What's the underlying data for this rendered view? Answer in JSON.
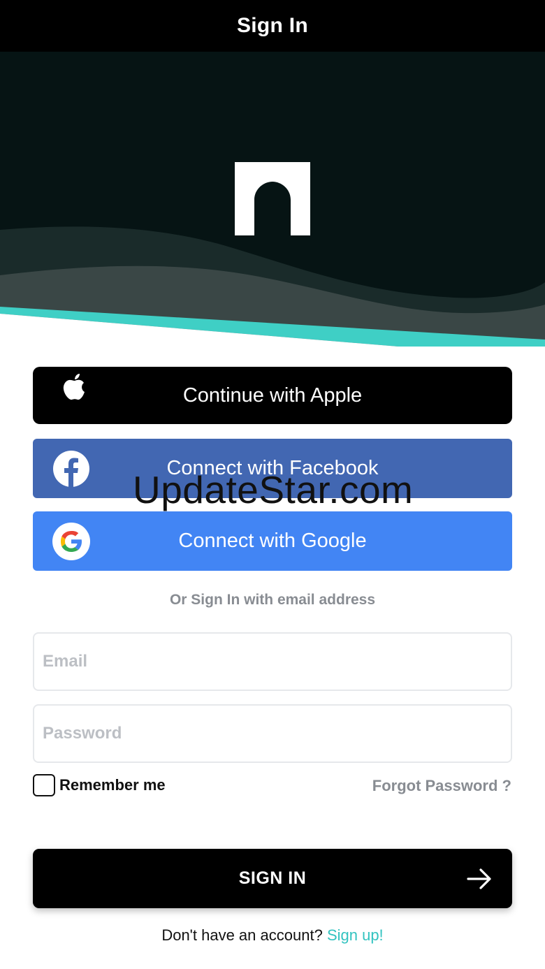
{
  "header": {
    "title": "Sign In"
  },
  "hero": {
    "logo": "M-logo",
    "wave_accent": "#3fcfc5",
    "background": "#061414"
  },
  "social": {
    "apple": {
      "label": "Continue with Apple",
      "icon": "apple-icon",
      "color": "#000000"
    },
    "facebook": {
      "label": "Connect with Facebook",
      "icon": "facebook-icon",
      "color": "#4267b2"
    },
    "google": {
      "label": "Connect with Google",
      "icon": "google-icon",
      "color": "#4285f4"
    }
  },
  "watermark": "UpdateStar.com",
  "divider_text": "Or Sign In with email address",
  "form": {
    "email_placeholder": "Email",
    "password_placeholder": "Password",
    "remember_label": "Remember me",
    "remember_checked": false,
    "forgot_label": "Forgot Password ?"
  },
  "submit": {
    "label": "SIGN IN",
    "icon": "arrow-right-icon"
  },
  "footer": {
    "prompt": "Don't have an account?",
    "link": "Sign up!",
    "link_color": "#33c3c0"
  }
}
